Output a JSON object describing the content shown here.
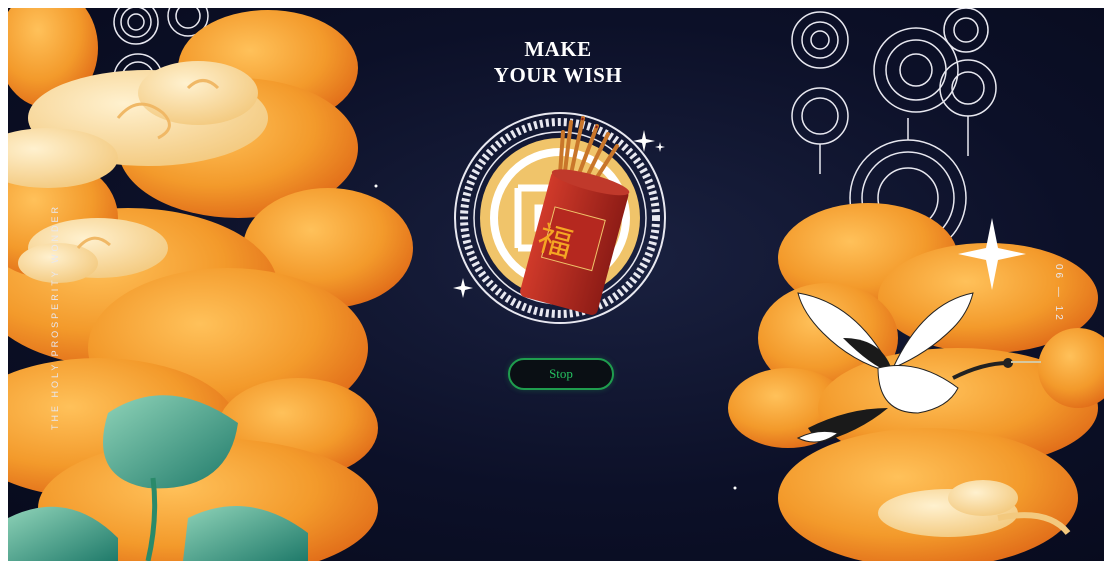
{
  "title": {
    "line1": "MAKE",
    "line2": "YOUR WISH"
  },
  "button": {
    "label": "Stop"
  },
  "side_text": {
    "left": "THE HOLY PROSPERITY WONDER",
    "right": "06 — 12"
  },
  "fortune": {
    "character": "福"
  },
  "icons": [
    "cloud-icon",
    "lantern-ornament-icon",
    "sparkle-star-icon",
    "crane-icon",
    "lotus-leaf-icon",
    "fortune-stick-cup-icon"
  ],
  "colors": {
    "background": "#0c1028",
    "cloud_orange": "#f39a2b",
    "cloud_cream": "#f8d9a0",
    "button_border": "#1f9d4e",
    "button_text": "#25c060",
    "red_cup": "#b5281f",
    "gold": "#f0c46a"
  }
}
